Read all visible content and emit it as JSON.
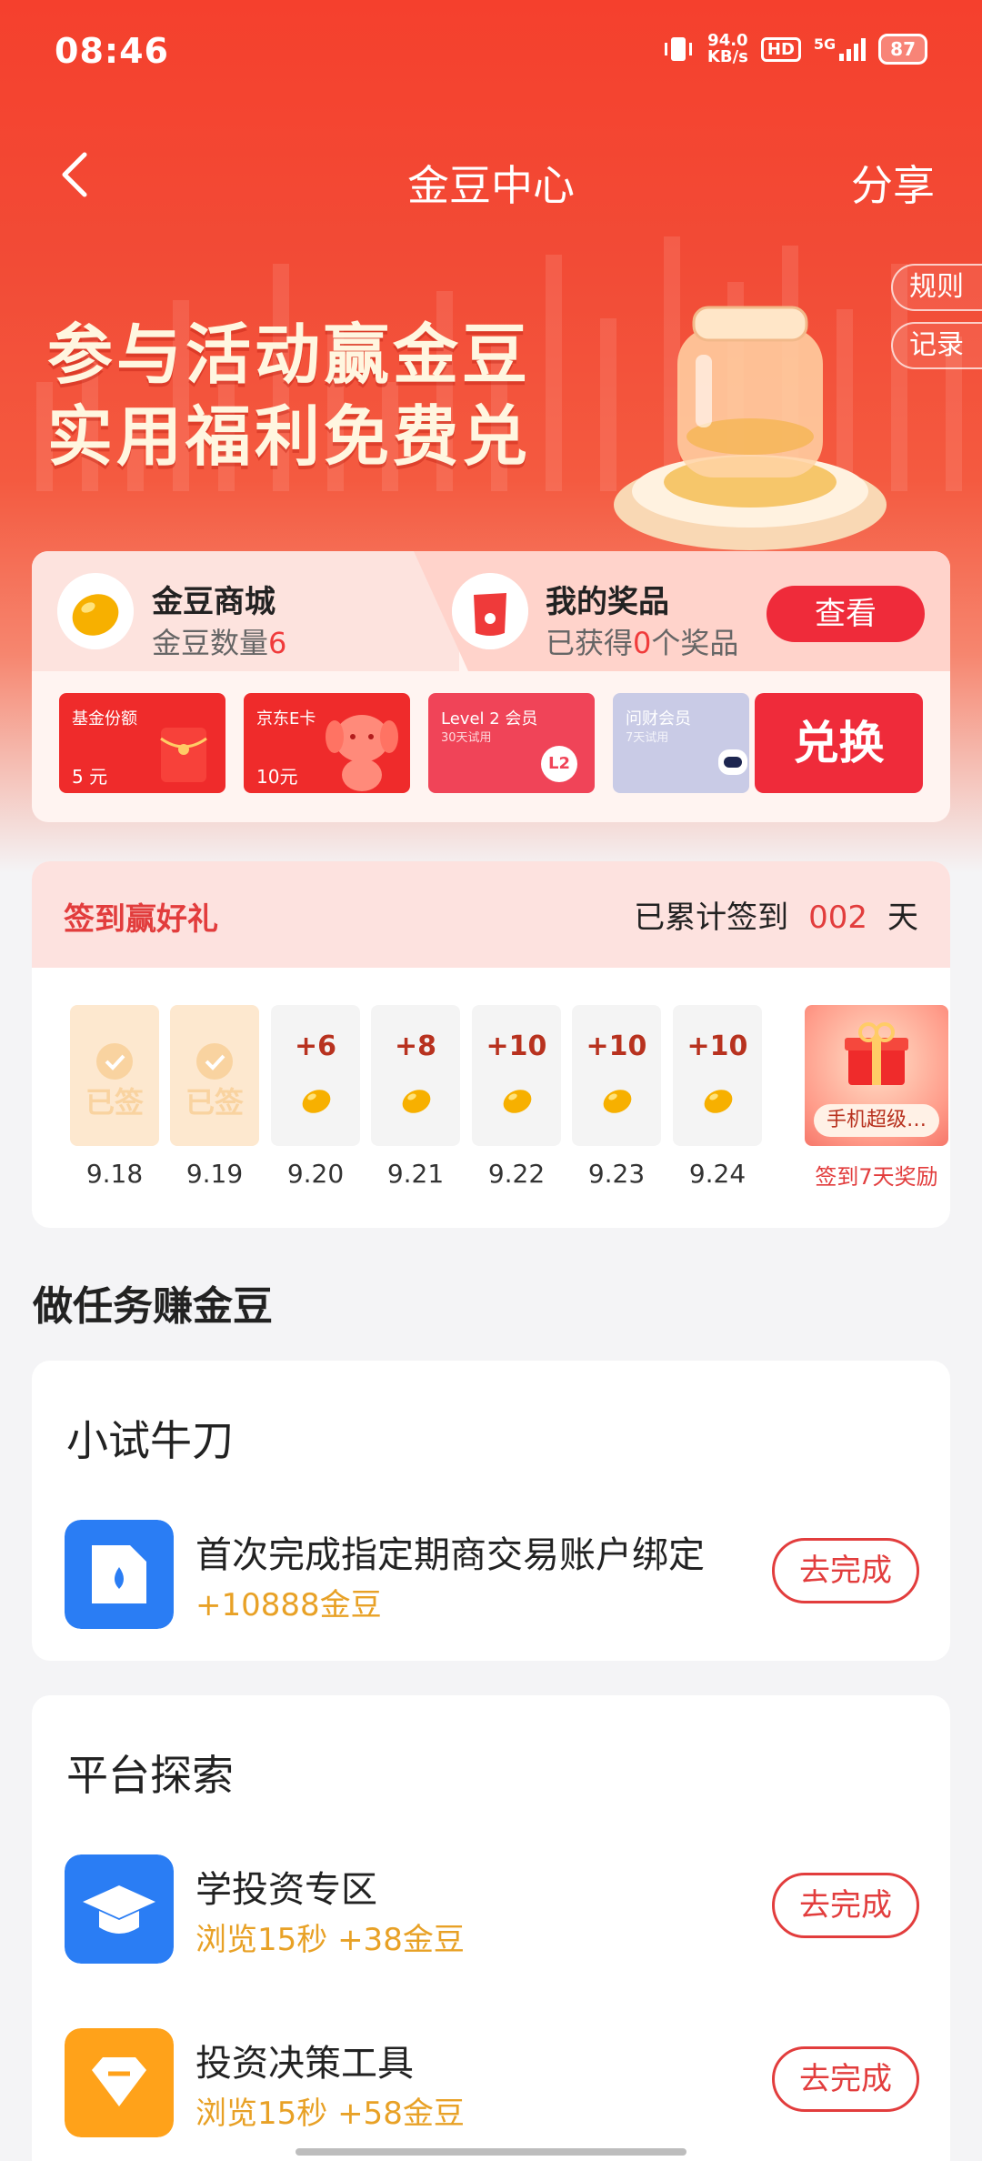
{
  "status": {
    "time": "08:46",
    "net_speed": "94.0",
    "net_unit": "KB/s",
    "hd": "HD",
    "signal": "5G",
    "battery": "87"
  },
  "nav": {
    "title": "金豆中心",
    "share": "分享"
  },
  "side": {
    "rules": "规则",
    "records": "记录"
  },
  "hero": {
    "line1": "参与活动赢金豆",
    "line2": "实用福利免费兑"
  },
  "mall": {
    "title": "金豆商城",
    "count_label": "金豆数量",
    "count_value": "6",
    "prize_title": "我的奖品",
    "prize_prefix": "已获得",
    "prize_value": "0",
    "prize_suffix": "个奖品",
    "view_button": "查看",
    "exchange_button": "兑换",
    "rewards": [
      {
        "name": "基金份额",
        "sub": "",
        "value": "5 元",
        "color": "#ef2b2b"
      },
      {
        "name": "京东E卡",
        "sub": "",
        "value": "10元",
        "color": "#ef2b2b"
      },
      {
        "name": "Level 2 会员",
        "sub": "30天试用",
        "value": "L2",
        "color": "#f04458"
      },
      {
        "name": "问财会员",
        "sub": "7天试用",
        "value": "",
        "color": "#c9cbe6"
      }
    ]
  },
  "sign": {
    "title": "签到赢好礼",
    "count_prefix": "已累计签到",
    "count_value": "002",
    "count_suffix": "天",
    "signed_text": "已签",
    "days": [
      {
        "date": "9.18",
        "state": "done",
        "points": ""
      },
      {
        "date": "9.19",
        "state": "done",
        "points": ""
      },
      {
        "date": "9.20",
        "state": "todo",
        "points": "+6"
      },
      {
        "date": "9.21",
        "state": "todo",
        "points": "+8"
      },
      {
        "date": "9.22",
        "state": "todo",
        "points": "+10"
      },
      {
        "date": "9.23",
        "state": "todo",
        "points": "+10"
      },
      {
        "date": "9.24",
        "state": "todo",
        "points": "+10"
      }
    ],
    "day7_tag": "手机超级…",
    "day7_label": "签到7天奖励"
  },
  "tasks_title": "做任务赚金豆",
  "groups": [
    {
      "title": "小试牛刀",
      "tasks": [
        {
          "title": "首次完成指定期商交易账户绑定",
          "reward": "+10888金豆",
          "button": "去完成",
          "icon": "document-icon",
          "color": "#2a7df4"
        }
      ]
    },
    {
      "title": "平台探索",
      "tasks": [
        {
          "title": "学投资专区",
          "reward": "浏览15秒 +38金豆",
          "button": "去完成",
          "icon": "graduation-cap-icon",
          "color": "#2a7df4"
        },
        {
          "title": "投资决策工具",
          "reward": "浏览15秒 +58金豆",
          "button": "去完成",
          "icon": "diamond-icon",
          "color": "#ffa21a"
        }
      ]
    }
  ]
}
